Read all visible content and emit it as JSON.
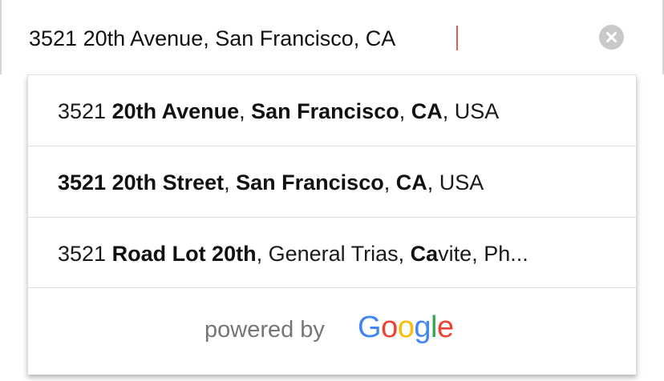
{
  "search": {
    "value": "3521 20th Avenue, San Francisco, CA",
    "clear_icon": "clear-circle-x-icon"
  },
  "suggestions": [
    {
      "parts": [
        {
          "text": "3521 ",
          "bold": false
        },
        {
          "text": "20th Avenue",
          "bold": true
        },
        {
          "text": ", ",
          "bold": false
        },
        {
          "text": "San Francisco",
          "bold": true
        },
        {
          "text": ", ",
          "bold": false
        },
        {
          "text": "CA",
          "bold": true
        },
        {
          "text": ", USA",
          "bold": false
        }
      ]
    },
    {
      "parts": [
        {
          "text": "3521 20th Street",
          "bold": true
        },
        {
          "text": ", ",
          "bold": false
        },
        {
          "text": "San Francisco",
          "bold": true
        },
        {
          "text": ", ",
          "bold": false
        },
        {
          "text": "CA",
          "bold": true
        },
        {
          "text": ", USA",
          "bold": false
        }
      ]
    },
    {
      "parts": [
        {
          "text": "3521 ",
          "bold": false
        },
        {
          "text": "Road Lot 20th",
          "bold": true
        },
        {
          "text": ", General Trias, ",
          "bold": false
        },
        {
          "text": "Ca",
          "bold": true
        },
        {
          "text": "vite, Ph...",
          "bold": false
        }
      ]
    }
  ],
  "attribution": {
    "text": "powered by",
    "logo_letters": [
      {
        "ch": "G",
        "color": "#4285F4"
      },
      {
        "ch": "o",
        "color": "#EA4335"
      },
      {
        "ch": "o",
        "color": "#FBBC05"
      },
      {
        "ch": "g",
        "color": "#4285F4"
      },
      {
        "ch": "l",
        "color": "#34A853"
      },
      {
        "ch": "e",
        "color": "#EA4335"
      }
    ]
  },
  "colors": {
    "caret": "#e85a58",
    "clear_button": "#c9c9c9",
    "attribution_text": "#757575"
  }
}
